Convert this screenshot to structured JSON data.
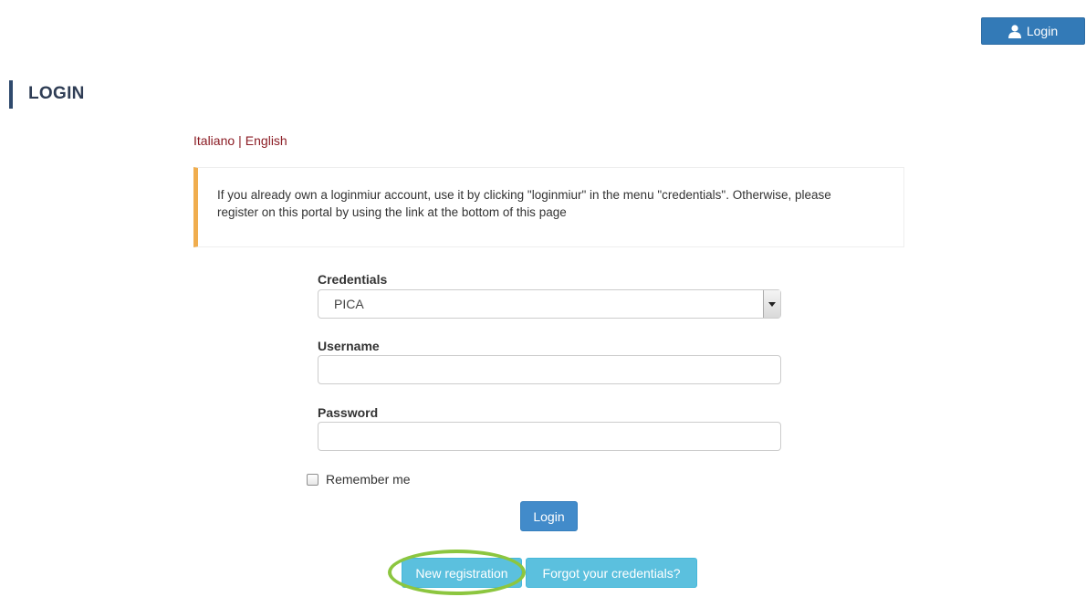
{
  "header": {
    "login_button_label": "Login",
    "icon": "user-icon"
  },
  "page": {
    "title": "LOGIN"
  },
  "language": {
    "italian": "Italiano",
    "separator": "|",
    "english": "English"
  },
  "notice": {
    "text": "If you already own a loginmiur account, use it by clicking \"loginmiur\" in the menu \"credentials\". Otherwise, please register on this portal by using the link at the bottom of this page",
    "accent_color": "#f0ad4e"
  },
  "form": {
    "credentials_label": "Credentials",
    "credentials_selected": "PICA",
    "username_label": "Username",
    "username_value": "",
    "password_label": "Password",
    "password_value": "",
    "remember_label": "Remember me",
    "remember_checked": false,
    "login_label": "Login"
  },
  "footer": {
    "new_registration_label": "New registration",
    "forgot_credentials_label": "Forgot your credentials?"
  },
  "colors": {
    "primary": "#337ab7",
    "info": "#5bc0de",
    "link": "#8b1c24",
    "highlight": "#8cc63f"
  }
}
